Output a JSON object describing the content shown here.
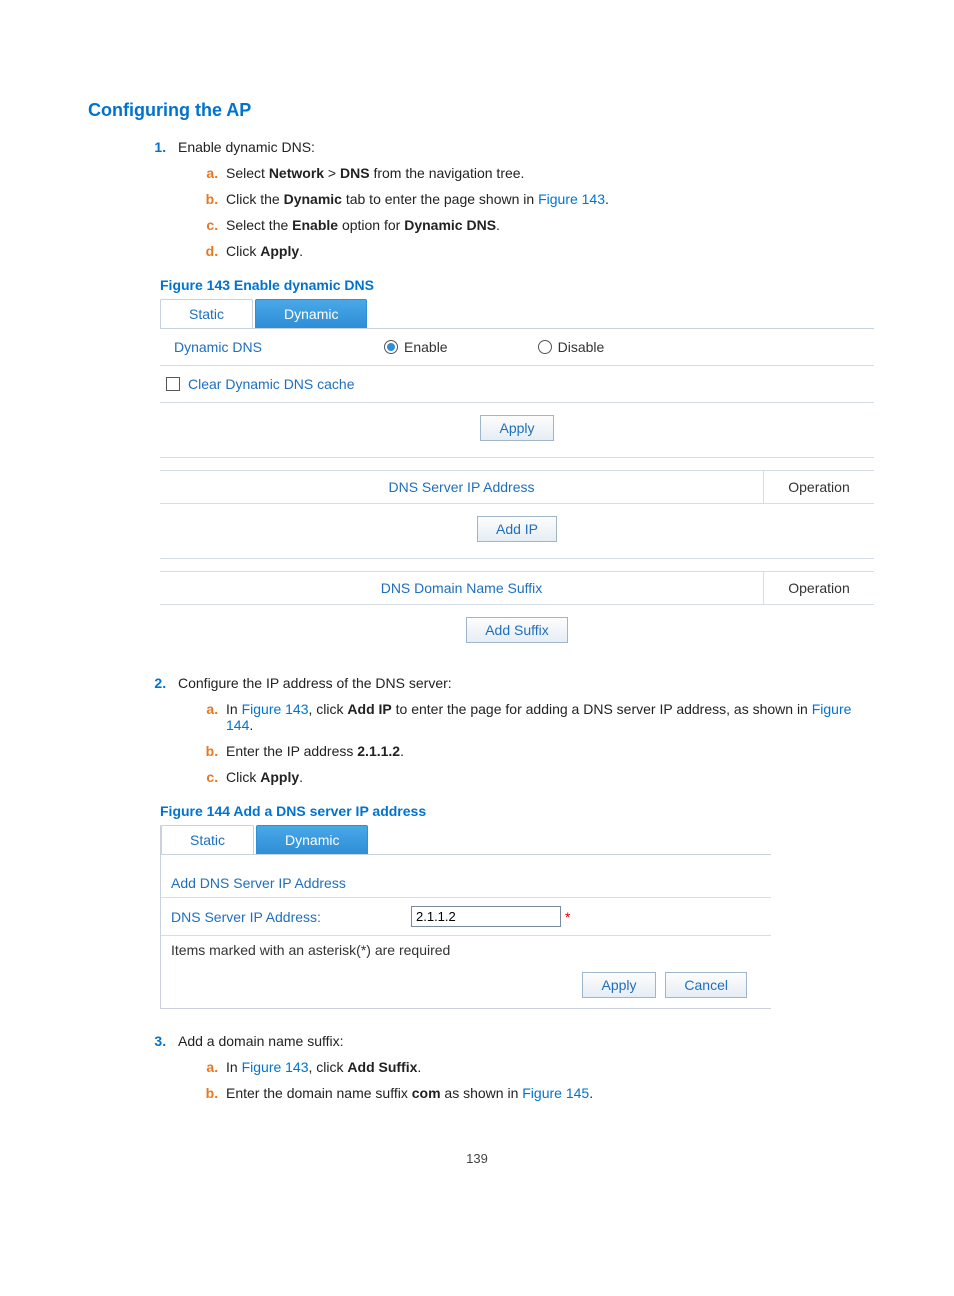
{
  "heading": "Configuring the AP",
  "step1": {
    "title": "Enable dynamic DNS:",
    "a_prefix": "Select ",
    "a_b1": "Network",
    "a_gt": " > ",
    "a_b2": "DNS",
    "a_suffix": " from the navigation tree.",
    "b_prefix": "Click the ",
    "b_b1": "Dynamic",
    "b_mid": " tab to enter the page shown in ",
    "b_link": "Figure 143",
    "b_suffix": ".",
    "c_prefix": "Select the ",
    "c_b1": "Enable",
    "c_mid": " option for ",
    "c_b2": "Dynamic DNS",
    "c_suffix": ".",
    "d_prefix": "Click ",
    "d_b1": "Apply",
    "d_suffix": "."
  },
  "fig143_caption": "Figure 143 Enable dynamic DNS",
  "fig143": {
    "tab_static": "Static",
    "tab_dynamic": "Dynamic",
    "row_label": "Dynamic DNS",
    "radio_enable": "Enable",
    "radio_disable": "Disable",
    "clear_cache": "Clear Dynamic DNS cache",
    "apply": "Apply",
    "th_ip": "DNS Server IP Address",
    "th_op": "Operation",
    "add_ip": "Add IP",
    "th_suffix": "DNS Domain Name Suffix",
    "add_suffix": "Add Suffix"
  },
  "step2": {
    "title": "Configure the IP address of the DNS server:",
    "a_prefix": "In ",
    "a_link1": "Figure 143",
    "a_mid1": ", click ",
    "a_b1": "Add IP",
    "a_mid2": " to enter the page for adding a DNS server IP address, as shown in ",
    "a_link2": "Figure 144",
    "a_suffix": ".",
    "b_prefix": "Enter the IP address ",
    "b_b1": "2.1.1.2",
    "b_suffix": ".",
    "c_prefix": "Click ",
    "c_b1": "Apply",
    "c_suffix": "."
  },
  "fig144_caption": "Figure 144 Add a DNS server IP address",
  "fig144": {
    "tab_static": "Static",
    "tab_dynamic": "Dynamic",
    "section": "Add DNS Server IP Address",
    "field_label": "DNS Server IP Address:",
    "field_value": "2.1.1.2",
    "asterisk": "*",
    "note": "Items marked with an asterisk(*) are required",
    "apply": "Apply",
    "cancel": "Cancel"
  },
  "step3": {
    "title": "Add a domain name suffix:",
    "a_prefix": "In ",
    "a_link": "Figure 143",
    "a_mid": ", click ",
    "a_b1": "Add Suffix",
    "a_suffix": ".",
    "b_prefix": "Enter the domain name suffix ",
    "b_b1": "com",
    "b_mid": " as shown in ",
    "b_link": "Figure 145",
    "b_suffix": "."
  },
  "page_number": "139"
}
